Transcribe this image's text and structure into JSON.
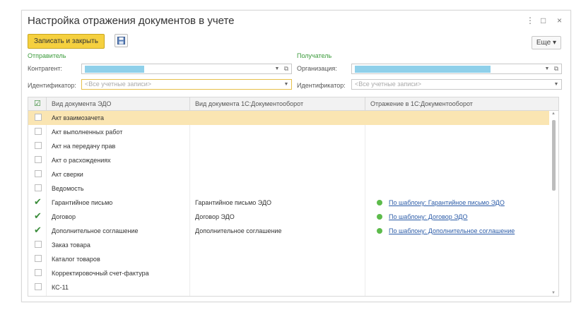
{
  "window": {
    "title": "Настройка отражения документов в учете",
    "menu_icon": "⋮",
    "maximize_icon": "□",
    "close_icon": "×"
  },
  "toolbar": {
    "save_close_label": "Записать и закрыть",
    "more_label": "Еще ▾"
  },
  "sender": {
    "section_label": "Отправитель",
    "counterparty_label": "Контрагент:",
    "identifier_label": "Идентификатор:",
    "identifier_placeholder": "<Все учетные записи>"
  },
  "recipient": {
    "section_label": "Получатель",
    "organization_label": "Организация:",
    "identifier_label": "Идентификатор:",
    "identifier_placeholder": "<Все учетные записи>"
  },
  "table": {
    "columns": [
      "Вид документа ЭДО",
      "Вид документа 1С:Документооборот",
      "Отражение в 1С:Документооборот"
    ],
    "rows": [
      {
        "checked": false,
        "edo": "Акт взаимозачета",
        "doc1c": "",
        "reflection": "",
        "selected": true
      },
      {
        "checked": false,
        "edo": "Акт выполненных работ",
        "doc1c": "",
        "reflection": ""
      },
      {
        "checked": false,
        "edo": "Акт на передачу прав",
        "doc1c": "",
        "reflection": ""
      },
      {
        "checked": false,
        "edo": "Акт о расхождениях",
        "doc1c": "",
        "reflection": ""
      },
      {
        "checked": false,
        "edo": "Акт сверки",
        "doc1c": "",
        "reflection": ""
      },
      {
        "checked": false,
        "edo": "Ведомость",
        "doc1c": "",
        "reflection": ""
      },
      {
        "checked": true,
        "edo": "Гарантийное письмо",
        "doc1c": "Гарантийное письмо ЭДО",
        "reflection": "По шаблону: Гарантийное письмо ЭДО"
      },
      {
        "checked": true,
        "edo": "Договор",
        "doc1c": "Договор ЭДО",
        "reflection": "По шаблону: Договор ЭДО"
      },
      {
        "checked": true,
        "edo": "Дополнительное соглашение",
        "doc1c": "Дополнительное соглашение",
        "reflection": "По шаблону: Дополнительное соглашение"
      },
      {
        "checked": false,
        "edo": "Заказ товара",
        "doc1c": "",
        "reflection": ""
      },
      {
        "checked": false,
        "edo": "Каталог товаров",
        "doc1c": "",
        "reflection": ""
      },
      {
        "checked": false,
        "edo": "Корректировочный счет-фактура",
        "doc1c": "",
        "reflection": ""
      },
      {
        "checked": false,
        "edo": "КС-11",
        "doc1c": "",
        "reflection": ""
      }
    ]
  },
  "colors": {
    "accent": "#f5d03f",
    "selection": "#fae5b2",
    "link": "#2c5ca8",
    "status_green": "#5dbb4b",
    "section_green": "#3b9b3b",
    "field_fill": "#8fd0ea"
  }
}
